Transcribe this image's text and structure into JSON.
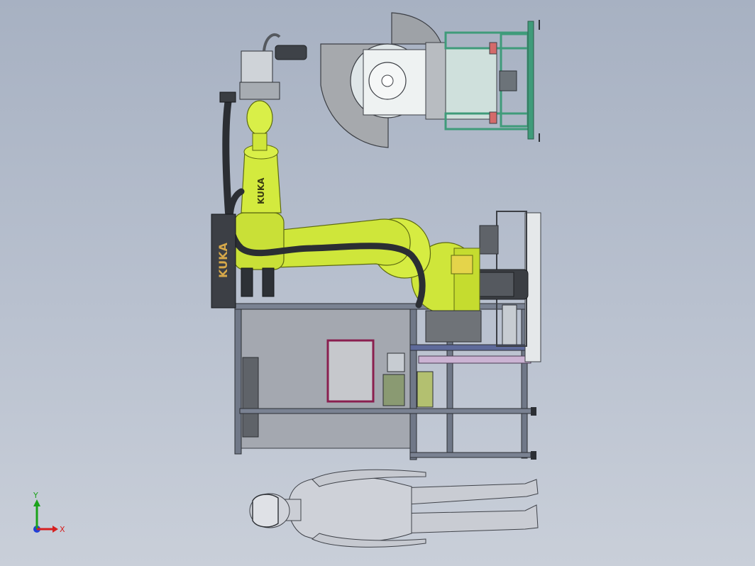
{
  "scene": {
    "robot_brand_arm": "KUKA",
    "robot_brand_base": "KUKA"
  },
  "triad": {
    "x_label": "X",
    "y_label": "Y",
    "x_color": "#d62020",
    "y_color": "#1aa21a",
    "z_color": "#2040d8"
  },
  "colors": {
    "robot_body": "#cfe63a",
    "robot_shadow": "#9fb321",
    "frame_metal": "#6e7688",
    "fixture_green": "#3f9b7a",
    "mannequin": "#c9ccd3",
    "panel_border": "#8a1f4f"
  }
}
